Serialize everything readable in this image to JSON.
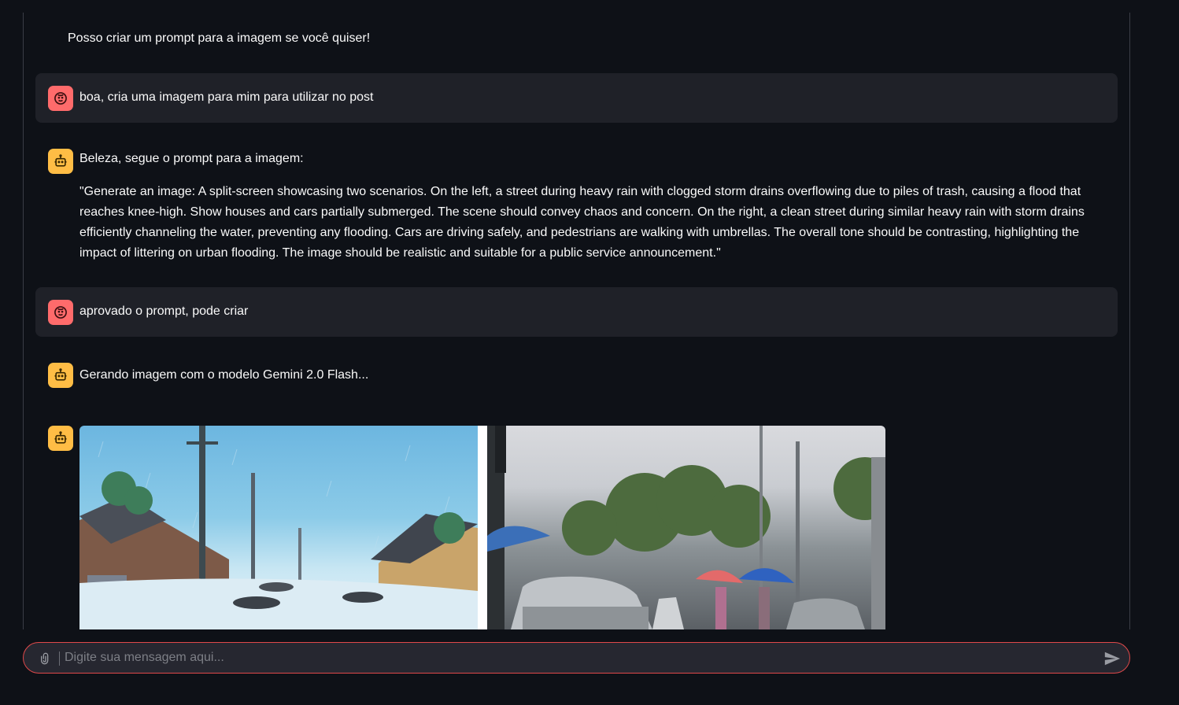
{
  "messages": [
    {
      "role": "assistant",
      "text": "Posso criar um prompt para a imagem se você quiser!"
    },
    {
      "role": "user",
      "text": "boa, cria uma imagem para mim para utilizar no post"
    },
    {
      "role": "assistant",
      "text": "Beleza, segue o prompt para a imagem:",
      "quote": "\"Generate an image: A split-screen showcasing two scenarios. On the left, a street during heavy rain with clogged storm drains overflowing due to piles of trash, causing a flood that reaches knee-high. Show houses and cars partially submerged. The scene should convey chaos and concern. On the right, a clean street during similar heavy rain with storm drains efficiently channeling the water, preventing any flooding. Cars are driving safely, and pedestrians are walking with umbrellas. The overall tone should be contrasting, highlighting the impact of littering on urban flooding. The image should be realistic and suitable for a public service announcement.\""
    },
    {
      "role": "user",
      "text": "aprovado o prompt, pode criar"
    },
    {
      "role": "assistant",
      "text": "Gerando imagem com o modelo Gemini 2.0 Flash..."
    },
    {
      "role": "assistant",
      "image": "generated-split-screen-image"
    }
  ],
  "input": {
    "placeholder": "Digite sua mensagem aqui...",
    "value": ""
  },
  "icons": {
    "user_avatar": "user-face-icon",
    "assistant_avatar": "robot-icon",
    "attach": "paperclip-icon",
    "send": "send-icon"
  },
  "colors": {
    "background": "#0e1117",
    "user_message_bg": "#1f2128",
    "user_avatar": "#ff6b6b",
    "assistant_avatar": "#ffbd45",
    "input_border": "#e0494a"
  }
}
